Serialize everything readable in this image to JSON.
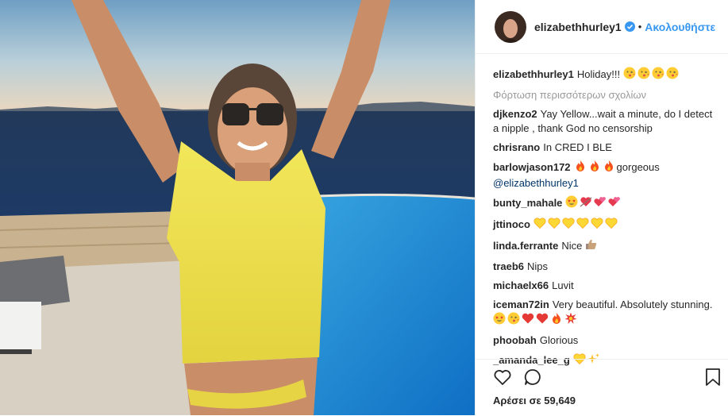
{
  "header": {
    "username": "elizabethhurley1",
    "follow_label": "Ακολουθήστε"
  },
  "caption": {
    "user": "elizabethhurley1",
    "text": "Holiday!!!",
    "emojis": [
      "kiss",
      "kiss",
      "kiss",
      "kiss"
    ]
  },
  "load_more": "Φόρτωση περισσότερων σχολίων",
  "comments": [
    {
      "user": "djkenzo2",
      "text": "Yay Yellow...wait a minute, do I detect a nipple , thank God no censorship",
      "emojis": []
    },
    {
      "user": "chrisrano",
      "text": "In CRED I BLE",
      "emojis": []
    },
    {
      "user": "barlowjason172",
      "text": "gorgeous",
      "mention": "@elizabethhurley1",
      "emojis": [
        "fire",
        "fire",
        "fire"
      ],
      "emoji_first": true
    },
    {
      "user": "bunty_mahale",
      "text": "",
      "emojis": [
        "star-eyes",
        "heart-arrow",
        "hearts",
        "hearts"
      ]
    },
    {
      "user": "jttinoco",
      "text": "",
      "emojis": [
        "yellow-heart",
        "yellow-heart",
        "yellow-heart",
        "yellow-heart",
        "yellow-heart",
        "yellow-heart"
      ]
    },
    {
      "user": "linda.ferrante",
      "text": "Nice",
      "emojis": [
        "thumbs-up"
      ]
    },
    {
      "user": "traeb6",
      "text": "Nips",
      "emojis": []
    },
    {
      "user": "michaelx66",
      "text": "Luvit",
      "emojis": []
    },
    {
      "user": "iceman72in",
      "text": "Very beautiful. Absolutely stunning.",
      "emojis": [
        "star-eyes",
        "kiss",
        "red-heart",
        "red-heart",
        "fire",
        "collision"
      ]
    },
    {
      "user": "phoobah",
      "text": "Glorious",
      "emojis": []
    },
    {
      "user": "_amanda_lee_g",
      "text": "",
      "emojis": [
        "yellow-heart",
        "sparkles"
      ]
    }
  ],
  "footer": {
    "like_icon": "heart-outline-icon",
    "comment_icon": "comment-bubble-icon",
    "save_icon": "bookmark-icon",
    "likes_text": "Αρέσει σε 59,649"
  },
  "colors": {
    "link": "#3897f0",
    "text": "#262626",
    "muted": "#999999",
    "border": "#efefef"
  }
}
